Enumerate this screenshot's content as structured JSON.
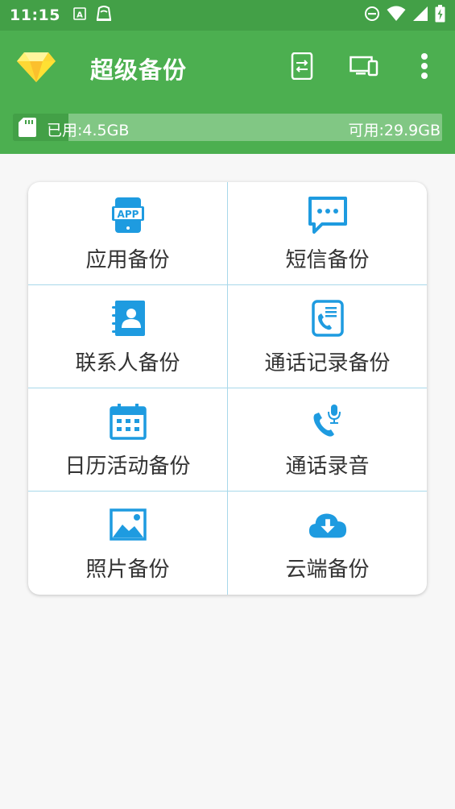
{
  "status_bar": {
    "time": "11:15",
    "left_icons": [
      "a-icon",
      "wifi-router-icon"
    ],
    "right_icons": [
      "do-not-disturb-icon",
      "wifi-icon",
      "signal-icon",
      "battery-charging-icon"
    ]
  },
  "app_bar": {
    "title": "超级备份",
    "actions": [
      "phone-transfer-icon",
      "devices-icon",
      "more-vert-icon"
    ]
  },
  "storage": {
    "used_label": "已用:4.5GB",
    "free_label": "可用:29.9GB",
    "used_fraction": 0.13
  },
  "grid": [
    {
      "label": "应用备份",
      "icon": "app-icon"
    },
    {
      "label": "短信备份",
      "icon": "message-icon"
    },
    {
      "label": "联系人备份",
      "icon": "contacts-icon"
    },
    {
      "label": "通话记录备份",
      "icon": "call-log-icon"
    },
    {
      "label": "日历活动备份",
      "icon": "calendar-icon"
    },
    {
      "label": "通话录音",
      "icon": "call-recording-icon"
    },
    {
      "label": "照片备份",
      "icon": "photo-icon"
    },
    {
      "label": "云端备份",
      "icon": "cloud-download-icon"
    }
  ],
  "colors": {
    "primary": "#4caf50",
    "primary_dark": "#43a047",
    "icon_blue": "#1e9be0",
    "divider": "#a8d8ea"
  }
}
